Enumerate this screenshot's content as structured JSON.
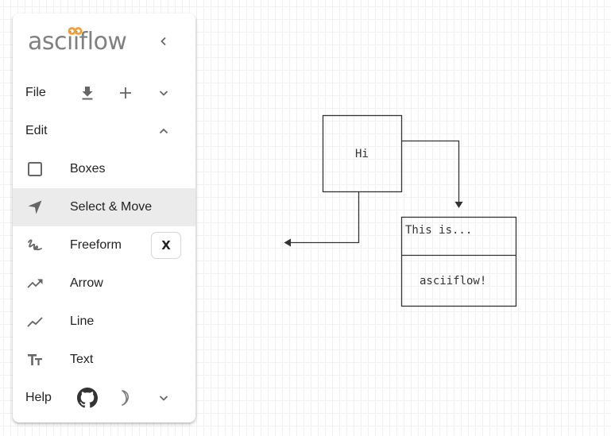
{
  "app": {
    "logo_text": "asciiflow",
    "brand_gray": "#808080",
    "brand_orange": "#F39C33"
  },
  "panel": {
    "collapse_icon": "chevron-left-icon",
    "file": {
      "label": "File",
      "actions": [
        {
          "name": "download",
          "icon": "download-icon"
        },
        {
          "name": "new",
          "icon": "plus-icon"
        },
        {
          "name": "expand",
          "icon": "chevron-down-icon"
        }
      ]
    },
    "edit": {
      "label": "Edit",
      "expanded": true,
      "toggle_icon": "chevron-up-icon"
    },
    "tools": [
      {
        "label": "Boxes",
        "icon": "square-outline-icon",
        "selected": false
      },
      {
        "label": "Select & Move",
        "icon": "navigation-arrow-icon",
        "selected": true
      },
      {
        "label": "Freeform",
        "icon": "gesture-icon",
        "selected": false,
        "shortcut": "X"
      },
      {
        "label": "Arrow",
        "icon": "trending-up-arrow-icon",
        "selected": false
      },
      {
        "label": "Line",
        "icon": "show-chart-line-icon",
        "selected": false
      },
      {
        "label": "Text",
        "icon": "text-fields-icon",
        "selected": false
      }
    ],
    "help": {
      "label": "Help",
      "actions": [
        {
          "name": "github",
          "icon": "github-icon"
        },
        {
          "name": "dark-mode",
          "icon": "moon-icon"
        },
        {
          "name": "expand",
          "icon": "chevron-down-icon"
        }
      ]
    }
  },
  "diagram": {
    "box_hi_text": "Hi",
    "box_two_top_text": "This is...",
    "box_two_bottom_text": "asciiflow!",
    "stroke_color": "#333333"
  }
}
